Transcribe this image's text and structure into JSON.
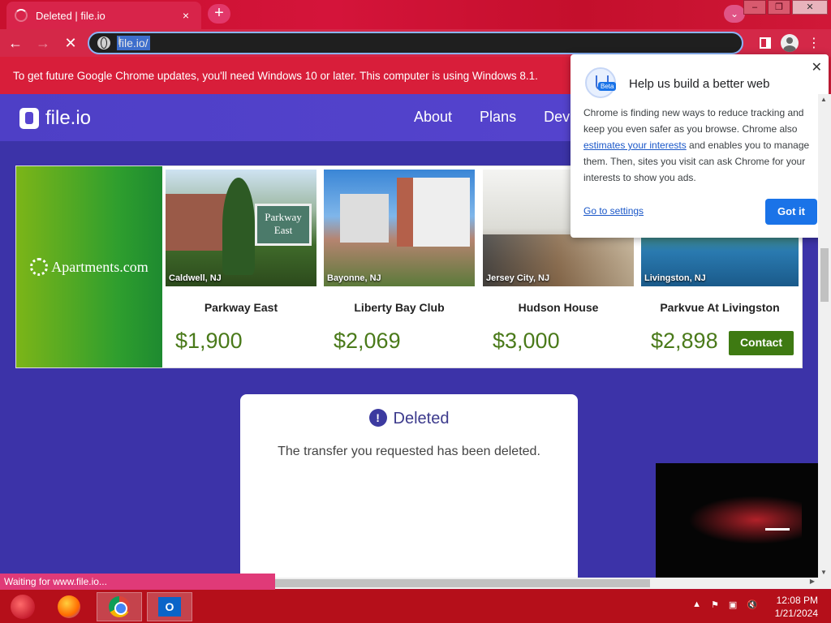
{
  "browser": {
    "tab_title": "Deleted | file.io",
    "tab_close": "×",
    "new_tab": "+",
    "tab_search": "⌄",
    "address": "file.io/",
    "window_controls": [
      "–",
      "❐",
      "✕"
    ]
  },
  "infobar": {
    "text": "To get future Google Chrome updates, you'll need Windows 10 or later. This computer is using Windows 8.1."
  },
  "site": {
    "logo": "file.io",
    "nav": [
      "About",
      "Plans",
      "Dev"
    ]
  },
  "ad": {
    "brand": "Apartments.com",
    "listings": [
      {
        "location": "Caldwell, NJ",
        "name": "Parkway East",
        "price": "$1,900"
      },
      {
        "location": "Bayonne, NJ",
        "name": "Liberty Bay Club",
        "price": "$2,069"
      },
      {
        "location": "Jersey City, NJ",
        "name": "Hudson House",
        "price": "$3,000"
      },
      {
        "location": "Livingston, NJ",
        "name": "Parkvue At Livingston",
        "price": "$2,898"
      }
    ],
    "contact_label": "Contact",
    "sign_text": "Parkway East"
  },
  "card": {
    "icon": "!",
    "title": "Deleted",
    "message": "The transfer you requested has been deleted."
  },
  "popup": {
    "badge": "Beta",
    "title": "Help us build a better web",
    "body_before": "Chrome is finding new ways to reduce tracking and keep you even safer as you browse. Chrome also ",
    "body_link": "estimates your interests",
    "body_after": " and enables you to manage them. Then, sites you visit can ask Chrome for your interests to show you ads.",
    "settings_link": "Go to settings",
    "button": "Got it",
    "close": "✕"
  },
  "status": "Waiting for www.file.io...",
  "taskbar": {
    "outlook_label": "O",
    "tray_icons": [
      "▲",
      "⚑",
      "▣",
      "🔇"
    ],
    "time": "12:08 PM",
    "date": "1/21/2024"
  }
}
